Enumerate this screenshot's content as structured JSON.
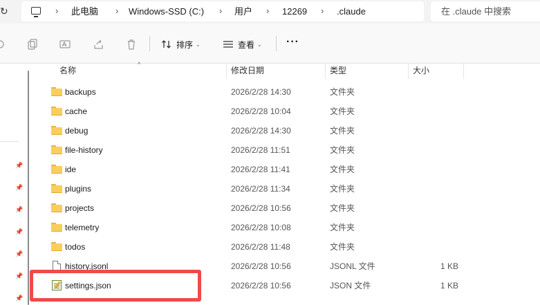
{
  "address_bar": {
    "breadcrumbs": [
      "此电脑",
      "Windows-SSD (C:)",
      "用户",
      "12269",
      ".claude"
    ],
    "search_placeholder": "在 .claude 中搜索"
  },
  "toolbar": {
    "sort_label": "排序",
    "view_label": "查看",
    "more_label": "···"
  },
  "columns": {
    "name": "名称",
    "modified": "修改日期",
    "type": "类型",
    "size": "大小"
  },
  "files": [
    {
      "name": "backups",
      "modified": "2026/2/28 14:30",
      "type": "文件夹",
      "size": "",
      "icon": "folder-icon"
    },
    {
      "name": "cache",
      "modified": "2026/2/28 10:04",
      "type": "文件夹",
      "size": "",
      "icon": "folder-icon"
    },
    {
      "name": "debug",
      "modified": "2026/2/28 14:30",
      "type": "文件夹",
      "size": "",
      "icon": "folder-icon"
    },
    {
      "name": "file-history",
      "modified": "2026/2/28 11:51",
      "type": "文件夹",
      "size": "",
      "icon": "folder-icon"
    },
    {
      "name": "ide",
      "modified": "2026/2/28 11:41",
      "type": "文件夹",
      "size": "",
      "icon": "folder-icon"
    },
    {
      "name": "plugins",
      "modified": "2026/2/28 11:34",
      "type": "文件夹",
      "size": "",
      "icon": "folder-icon"
    },
    {
      "name": "projects",
      "modified": "2026/2/28 10:56",
      "type": "文件夹",
      "size": "",
      "icon": "folder-icon"
    },
    {
      "name": "telemetry",
      "modified": "2026/2/28 10:08",
      "type": "文件夹",
      "size": "",
      "icon": "folder-icon"
    },
    {
      "name": "todos",
      "modified": "2026/2/28 11:48",
      "type": "文件夹",
      "size": "",
      "icon": "folder-icon"
    },
    {
      "name": "history.jsonl",
      "modified": "2026/2/28 10:56",
      "type": "JSONL 文件",
      "size": "1 KB",
      "icon": "file-icon"
    },
    {
      "name": "settings.json",
      "modified": "2026/2/28 10:56",
      "type": "JSON 文件",
      "size": "1 KB",
      "icon": "json-file-icon"
    }
  ],
  "highlight_color": "#f04a4a"
}
